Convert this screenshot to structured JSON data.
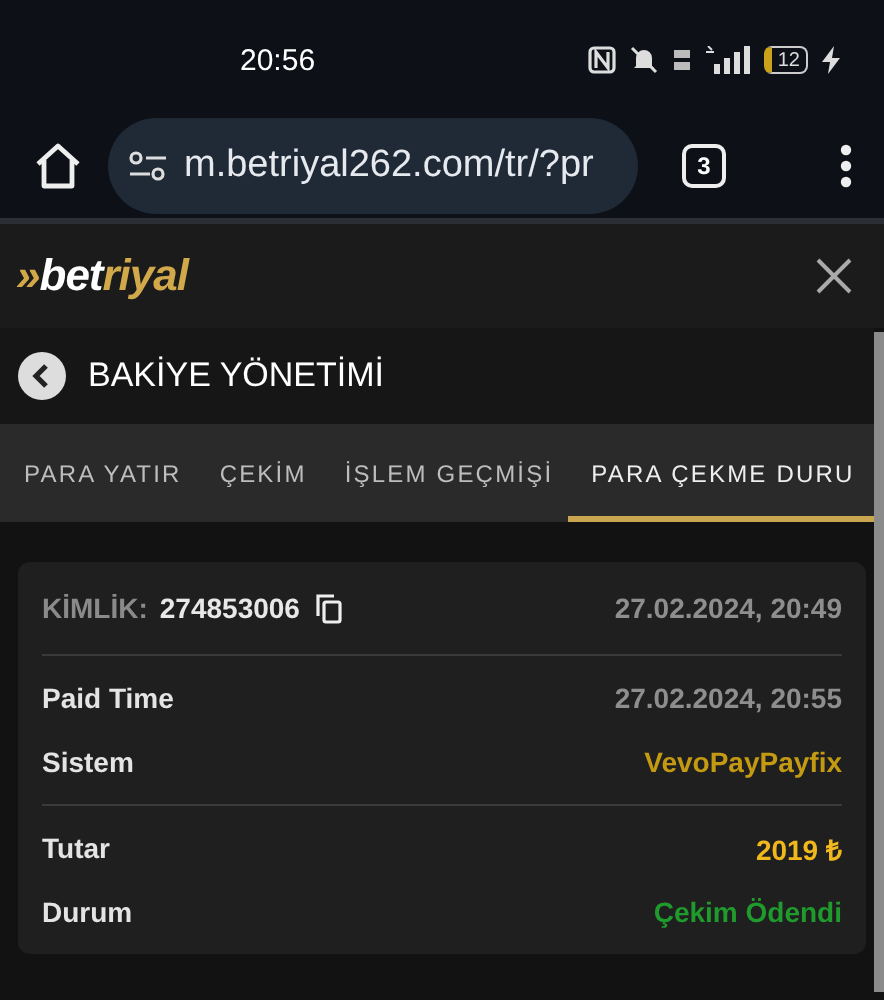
{
  "status_bar": {
    "time": "20:56",
    "battery": "12"
  },
  "browser": {
    "url": "m.betriyal262.com/tr/?pr",
    "tab_count": "3"
  },
  "header": {
    "logo": {
      "mark": "»",
      "first": "bet",
      "second": "riyal"
    }
  },
  "page": {
    "title": "BAKİYE YÖNETİMİ"
  },
  "tabs": [
    {
      "label": "PARA YATIR",
      "selected": false
    },
    {
      "label": "ÇEKİM",
      "selected": false
    },
    {
      "label": "İŞLEM GEÇMİŞİ",
      "selected": false
    },
    {
      "label": "PARA ÇEKME DURU",
      "selected": true
    }
  ],
  "record": {
    "id_label": "KİMLİK:",
    "id_value": "274853006",
    "created": "27.02.2024, 20:49",
    "sections": [
      [
        {
          "label": "Paid Time",
          "value": "27.02.2024, 20:55",
          "color": "#8e8e8e"
        },
        {
          "label": "Sistem",
          "value": "VevoPayPayfix",
          "color": "#c49a12"
        }
      ],
      [
        {
          "label": "Tutar",
          "value": "2019 ₺",
          "color": "#f0b81c"
        },
        {
          "label": "Durum",
          "value": "Çekim Ödendi",
          "color": "#1f9a2c"
        }
      ]
    ]
  }
}
